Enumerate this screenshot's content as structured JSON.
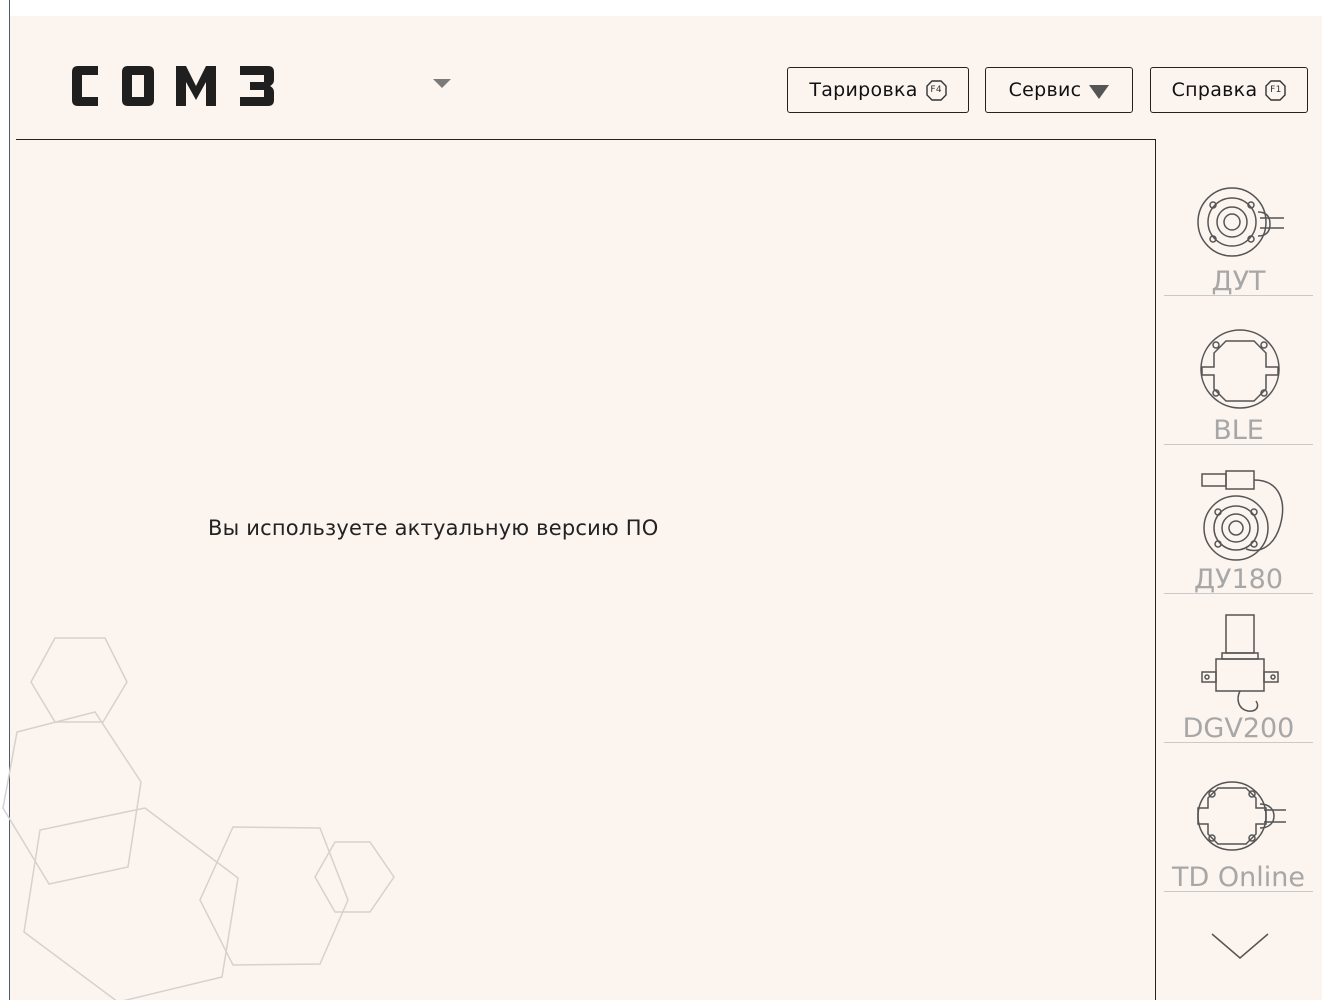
{
  "app": {
    "logo_text": "COM3"
  },
  "header": {
    "buttons": {
      "calibration": {
        "label": "Тарировка",
        "key": "F4"
      },
      "service": {
        "label": "Сервис"
      },
      "help": {
        "label": "Справка",
        "key": "F1"
      }
    }
  },
  "main": {
    "message": "Вы используете актуальную версию ПО"
  },
  "sidebar": {
    "devices": [
      {
        "label": "ДУТ",
        "icon": "sensor-with-cable-icon"
      },
      {
        "label": "BLE",
        "icon": "round-sensor-icon"
      },
      {
        "label": "ДУ180",
        "icon": "sensor-with-connector-icon"
      },
      {
        "label": "DGV200",
        "icon": "pressure-sensor-icon"
      },
      {
        "label": "TD Online",
        "icon": "sensor-with-cable-icon"
      }
    ],
    "scroll_icon": "chevron-down-icon"
  },
  "colors": {
    "background": "#fcf4ef",
    "outline": "#222222",
    "device_label": "#a7a7a7"
  }
}
